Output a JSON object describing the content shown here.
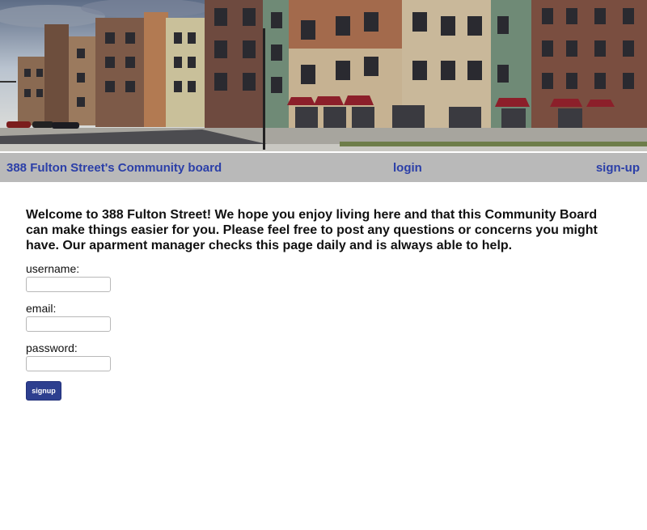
{
  "nav": {
    "home_label": "388 Fulton Street's Community board",
    "login_label": "login",
    "signup_label": "sign-up"
  },
  "main": {
    "welcome_text": "Welcome to 388 Fulton Street! We hope you enjoy living here and that this Community Board can make things easier for you. Please feel free to post any questions or concerns you might have. Our aparment manager checks this page daily and is always able to help."
  },
  "form": {
    "username_label": "username:",
    "username_value": "",
    "email_label": "email:",
    "email_value": "",
    "password_label": "password:",
    "password_value": "",
    "submit_label": "signup"
  },
  "colors": {
    "nav_background": "#b9b9b9",
    "nav_link": "#2b3fa8",
    "button_background": "#2d3f8f"
  }
}
